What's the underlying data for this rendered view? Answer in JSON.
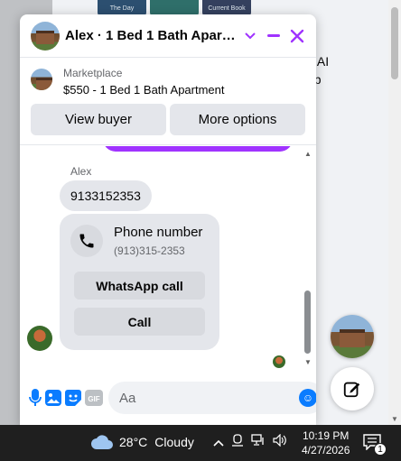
{
  "chat": {
    "title": "Alex · 1 Bed 1 Bath Apartm…",
    "listing": {
      "label": "Marketplace",
      "title": "$550 - 1 Bed 1 Bath Apartment",
      "view_buyer": "View buyer",
      "more_options": "More options"
    },
    "messages": {
      "sender_name": "Alex",
      "phone_text": "9133152353",
      "card": {
        "title": "Phone number",
        "number": "(913)315-2353",
        "whatsapp": "WhatsApp call",
        "call": "Call"
      }
    },
    "composer": {
      "placeholder": "Aa"
    }
  },
  "background": {
    "thumbnail_caption_1": "The Day",
    "thumbnail_caption_3": "Current Book",
    "text_line_1": "d AI",
    "text_line_2": "pp"
  },
  "taskbar": {
    "temperature": "28°C",
    "weather": "Cloudy",
    "time": "10:19 PM",
    "date": "4/27/2026",
    "notification_count": "1"
  },
  "colors": {
    "accent": "#a033ff",
    "messenger_blue": "#0a7cff"
  }
}
